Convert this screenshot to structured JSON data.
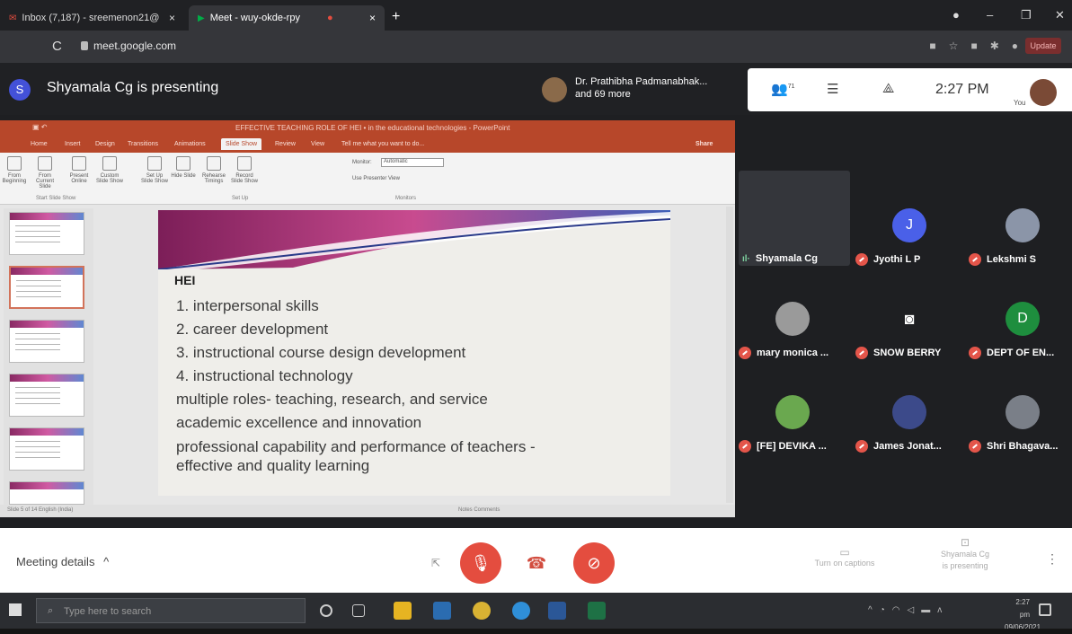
{
  "browser": {
    "tabs": [
      {
        "title": "Inbox (7,187) - sreemenon21@",
        "close": "×"
      },
      {
        "title": "Meet - wuy-okde-rpy",
        "close": "×"
      }
    ],
    "new_tab": "+",
    "window_controls": {
      "minimize": "–",
      "maximize": "❐",
      "close": "✕"
    },
    "url": "meet.google.com",
    "reload": "C",
    "update_label": "Update"
  },
  "meet_header": {
    "presenter_initial": "S",
    "presenting_text": "Shyamala Cg is presenting",
    "host_line1": "Dr. Prathibha Padmanabhak...",
    "host_line2": "and 69 more",
    "participants_count": "71",
    "time": "2:27 PM",
    "you_label": "You"
  },
  "powerpoint": {
    "title": "EFFECTIVE TEACHING ROLE OF HEI • in the educational technologies  -  PowerPoint",
    "share_label": "Share",
    "tabs": [
      "Home",
      "Insert",
      "Design",
      "Transitions",
      "Animations",
      "Slide Show",
      "Review",
      "View",
      "Tell me what you want to do..."
    ],
    "active_tab": "Slide Show",
    "ribbon_items": [
      "From Beginning",
      "From Current Slide",
      "Present Online",
      "Custom Slide Show",
      "Set Up Slide Show",
      "Hide Slide",
      "Rehearse Timings",
      "Record Slide Show"
    ],
    "ribbon_groups": [
      "Start Slide Show",
      "Set Up",
      "Monitors"
    ],
    "monitor_label": "Monitor:",
    "monitor_value": "Automatic",
    "presenter_view": "Use Presenter View",
    "status_left": "Slide 5 of 14    English (India)",
    "status_right": "Notes    Comments"
  },
  "slide": {
    "title": "HEI",
    "lines": [
      "1. interpersonal skills",
      "2. career development",
      "3. instructional course design development",
      "4.  instructional technology",
      "multiple roles- teaching, research, and service",
      "academic excellence and innovation",
      "professional capability and performance of teachers -",
      "effective and quality learning"
    ]
  },
  "participants": [
    {
      "name": "Shyamala Cg",
      "initial": "",
      "color": "#34363b",
      "speaking": true
    },
    {
      "name": "Jyothi L P",
      "initial": "J",
      "color": "#4a60e8"
    },
    {
      "name": "Lekshmi S",
      "initial": "",
      "color": "#8b95a8"
    },
    {
      "name": "mary monica ...",
      "initial": "",
      "color": "#9a9a9a"
    },
    {
      "name": "SNOW BERRY",
      "initial": "",
      "color": "#3a3a3a"
    },
    {
      "name": "DEPT OF EN...",
      "initial": "D",
      "color": "#1e8e3e"
    },
    {
      "name": "[FE] DEVIKA ...",
      "initial": "",
      "color": "#6aa84f"
    },
    {
      "name": "James Jonat...",
      "initial": "",
      "color": "#3c4a8a"
    },
    {
      "name": "Shri Bhagava...",
      "initial": "",
      "color": "#7a7f88"
    }
  ],
  "controls": {
    "meeting_details": "Meeting details",
    "caret": "^",
    "captions": "Turn on captions",
    "presenting_line1": "Shyamala Cg",
    "presenting_line2": "is presenting",
    "more": "⋮"
  },
  "taskbar": {
    "search_placeholder": "Type here to search",
    "time": "2:27 pm",
    "date": "09/06/2021"
  },
  "colors": {
    "ppt_red": "#b7472a",
    "mic_off": "#e44d3f",
    "meet_dark": "#202124"
  }
}
